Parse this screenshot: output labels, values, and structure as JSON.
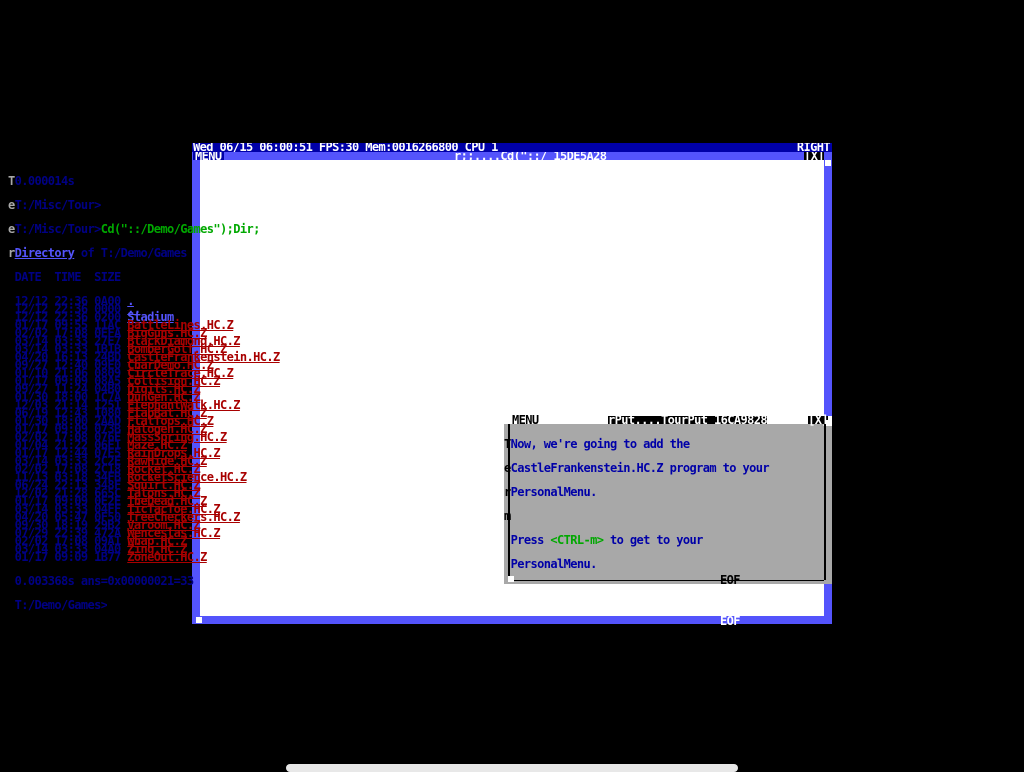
{
  "status_bar": {
    "left": "Wed 06/15 06:00:51 FPS:30 Mem:0016266800 CPU 1",
    "right": "RIGHT"
  },
  "main_window": {
    "menu_label": "MENU",
    "title_path": "r;;....Cd(\"::/ 15DE5A28",
    "close_label": "[X]",
    "eof_label": "EOF"
  },
  "terminal": {
    "line1": "0.000014s",
    "line2": "T:/Misc/Tour>",
    "line3_prompt": "T:/Misc/Tour>",
    "line3_cmd": "Cd(\"::/Demo/Games\");Dir;",
    "dir_word": "Directory",
    "dir_rest": " of T:/Demo/Games",
    "header": "DATE  TIME  SIZE",
    "rows": [
      {
        "date": "12/12",
        "time": "22:36",
        "size": "0A00",
        "name": ".",
        "kind": "dir"
      },
      {
        "date": "12/12",
        "time": "22:36",
        "size": "0000",
        "name": "..",
        "kind": "dir"
      },
      {
        "date": "12/12",
        "time": "22:36",
        "size": "0200",
        "name": "Stadium",
        "kind": "dir"
      },
      {
        "date": "01/17",
        "time": "09:55",
        "size": "11AC",
        "name": "BattleLines.HC.Z",
        "kind": "file"
      },
      {
        "date": "02/02",
        "time": "17:08",
        "size": "0EFA",
        "name": "BigGuns.HC.Z",
        "kind": "file"
      },
      {
        "date": "03/14",
        "time": "03:33",
        "size": "27E7",
        "name": "BlackDiamond.HC.Z",
        "kind": "file"
      },
      {
        "date": "03/14",
        "time": "03:33",
        "size": "1B1B",
        "name": "BomberGolf.HC.Z",
        "kind": "file"
      },
      {
        "date": "04/20",
        "time": "16:13",
        "size": "24BD",
        "name": "CastleFrankenstein.HC.Z",
        "kind": "file"
      },
      {
        "date": "09/27",
        "time": "12:40",
        "size": "09E0",
        "name": "CharDemo.HC.Z",
        "kind": "file"
      },
      {
        "date": "01/10",
        "time": "21:06",
        "size": "0809",
        "name": "CircleTrace.HC.Z",
        "kind": "file"
      },
      {
        "date": "01/17",
        "time": "09:09",
        "size": "08A5",
        "name": "Collision.HC.Z",
        "kind": "file"
      },
      {
        "date": "09/27",
        "time": "11:24",
        "size": "04B0",
        "name": "Digits.HC.Z",
        "kind": "file"
      },
      {
        "date": "01/30",
        "time": "18:00",
        "size": "1C7A",
        "name": "DunGen.HC.Z",
        "kind": "file"
      },
      {
        "date": "12/03",
        "time": "21:14",
        "size": "1251",
        "name": "ElephantWalk.HC.Z",
        "kind": "file"
      },
      {
        "date": "06/19",
        "time": "12:43",
        "size": "1080",
        "name": "FlapBat.HC.Z",
        "kind": "file"
      },
      {
        "date": "01/30",
        "time": "18:00",
        "size": "2AAD",
        "name": "FlatTops.HC.Z",
        "kind": "file"
      },
      {
        "date": "01/17",
        "time": "09:09",
        "size": "073B",
        "name": "Halogen.HC.Z",
        "kind": "file"
      },
      {
        "date": "02/02",
        "time": "17:08",
        "size": "076E",
        "name": "MassSpring.HC.Z",
        "kind": "file"
      },
      {
        "date": "01/04",
        "time": "21:22",
        "size": "06E1",
        "name": "Maze.HC.Z",
        "kind": "file"
      },
      {
        "date": "01/17",
        "time": "12:44",
        "size": "07E5",
        "name": "RainDrops.HC.Z",
        "kind": "file"
      },
      {
        "date": "03/14",
        "time": "03:33",
        "size": "2C2E",
        "name": "RawHide.HC.Z",
        "kind": "file"
      },
      {
        "date": "02/02",
        "time": "17:08",
        "size": "2C18",
        "name": "Rocket.HC.Z",
        "kind": "file"
      },
      {
        "date": "11/13",
        "time": "03:18",
        "size": "34FB",
        "name": "RocketScience.HC.Z",
        "kind": "file"
      },
      {
        "date": "06/24",
        "time": "22:13",
        "size": "348F",
        "name": "Squirt.HC.Z",
        "kind": "file"
      },
      {
        "date": "12/02",
        "time": "21:28",
        "size": "665C",
        "name": "Talons.HC.Z",
        "kind": "file"
      },
      {
        "date": "01/17",
        "time": "09:09",
        "size": "0E2E",
        "name": "TheDead.HC.Z",
        "kind": "file"
      },
      {
        "date": "03/14",
        "time": "03:33",
        "size": "04FF",
        "name": "TicTacToe.HC.Z",
        "kind": "file"
      },
      {
        "date": "04/20",
        "time": "05:47",
        "size": "0F50",
        "name": "TreeCheckers.HC.Z",
        "kind": "file"
      },
      {
        "date": "09/30",
        "time": "18:19",
        "size": "29B2",
        "name": "Varoom.HC.Z",
        "kind": "file"
      },
      {
        "date": "07/29",
        "time": "22:39",
        "size": "472A",
        "name": "Wenceslas.HC.Z",
        "kind": "file"
      },
      {
        "date": "02/02",
        "time": "17:08",
        "size": "09A1",
        "name": "Whap.HC.Z",
        "kind": "file"
      },
      {
        "date": "03/14",
        "time": "03:33",
        "size": "04A0",
        "name": "Zing.HC.Z",
        "kind": "file"
      },
      {
        "date": "01/17",
        "time": "09:09",
        "size": "1B77",
        "name": "ZoneOut.HC.Z",
        "kind": "file"
      }
    ],
    "result": "0.003368s ans=0x00000021=33",
    "prompt": "T:/Demo/Games>"
  },
  "popup": {
    "menu_label": "MENU",
    "cmd_label": "rPut....TourPut 16CA9828",
    "close_label": "[X]",
    "eof_label": "EOF",
    "line1": "Now, we're going to add the",
    "line2": "CastleFrankenstein.HC.Z program to your",
    "line3": "PersonalMenu.",
    "line4_pre": "Press ",
    "line4_key": "<CTRL-m>",
    "line4_post": " to get to your",
    "line5": "PersonalMenu."
  }
}
